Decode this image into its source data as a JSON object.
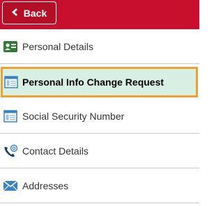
{
  "header": {
    "back_label": "Back",
    "accent_color": "#c8102e"
  },
  "menu": {
    "items": [
      {
        "label": "Personal Details",
        "icon": "id-card-icon"
      },
      {
        "label": "Personal Info Change Request",
        "icon": "window-form-icon",
        "selected": true
      },
      {
        "label": "Social Security Number",
        "icon": "window-form-icon"
      },
      {
        "label": "Contact Details",
        "icon": "phone-at-icon"
      },
      {
        "label": "Addresses",
        "icon": "envelope-icon"
      }
    ],
    "selected_bg": "#d8f0e4",
    "selected_border": "#f0a030"
  }
}
